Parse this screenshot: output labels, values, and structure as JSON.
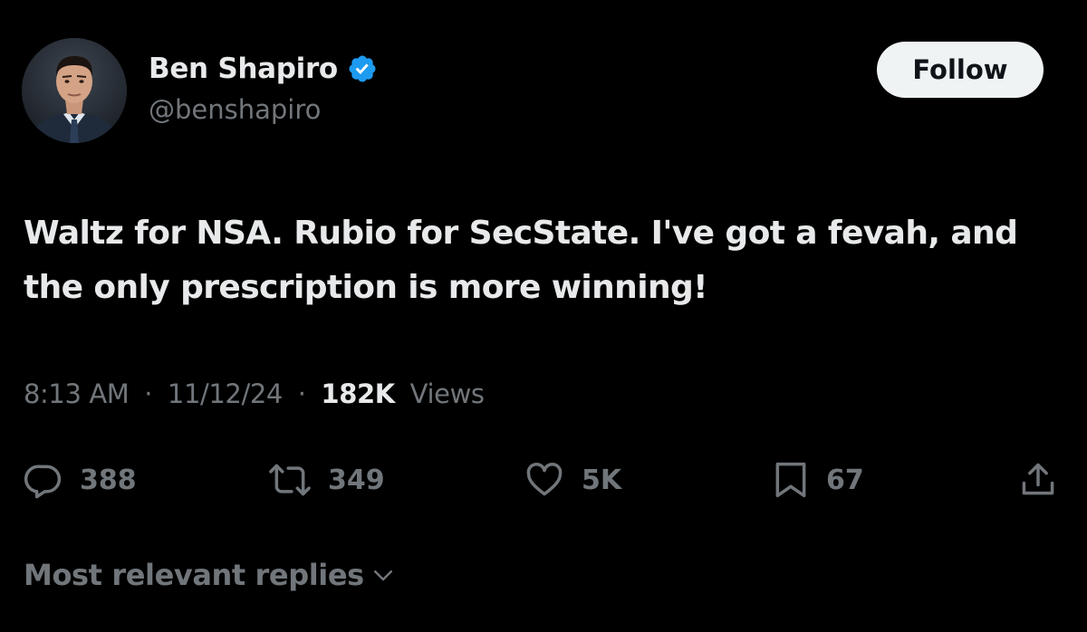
{
  "author": {
    "name": "Ben Shapiro",
    "handle": "@benshapiro",
    "verified": true
  },
  "follow_button": {
    "label": "Follow"
  },
  "tweet": {
    "text": "Waltz for NSA. Rubio for SecState. I've got a fevah, and the only prescription is more winning!",
    "time": "8:13 AM",
    "date": "11/12/24",
    "separator": "·",
    "views_count": "182K",
    "views_label": "Views"
  },
  "actions": {
    "replies": "388",
    "reposts": "349",
    "likes": "5K",
    "bookmarks": "67"
  },
  "replies_sort": {
    "label": "Most relevant replies"
  },
  "colors": {
    "background": "#000000",
    "text_primary": "#e7e9ea",
    "text_secondary": "#71767b",
    "verified_blue": "#1d9bf0",
    "follow_bg": "#eff3f4"
  },
  "icons": {
    "verified": "verified-badge-icon",
    "reply": "reply-bubble-icon",
    "repost": "repost-arrows-icon",
    "like": "heart-icon",
    "bookmark": "bookmark-icon",
    "share": "share-upload-icon",
    "chevron": "chevron-down-icon"
  }
}
